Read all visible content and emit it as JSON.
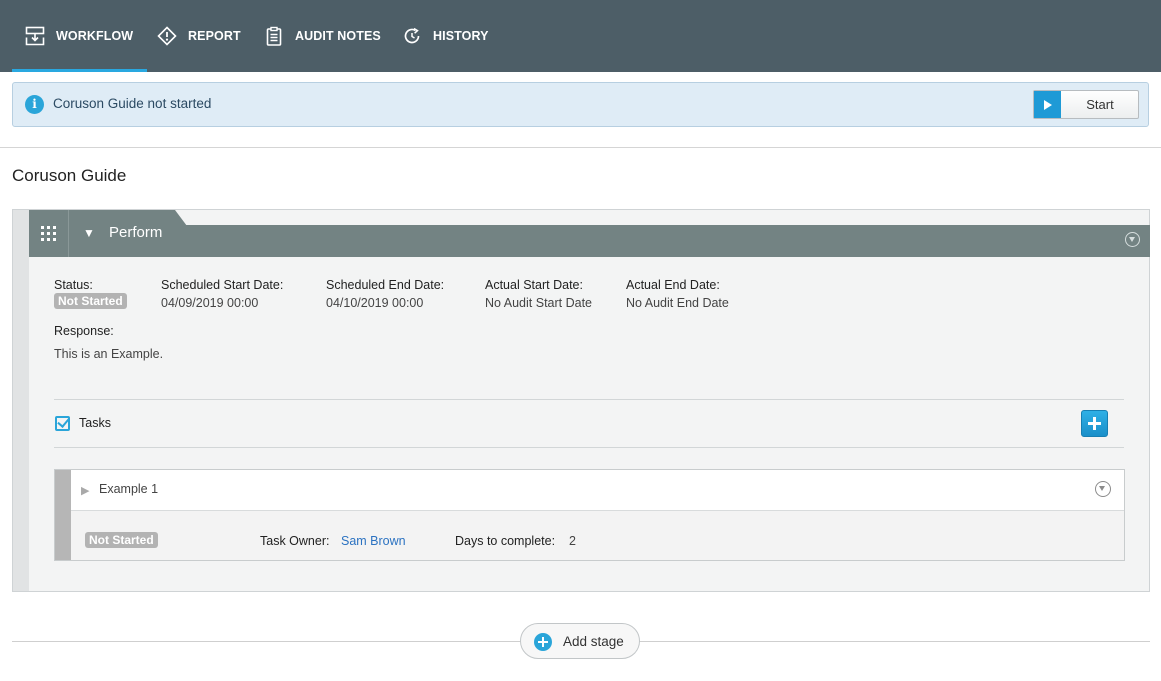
{
  "nav": {
    "tabs": [
      {
        "label": "WORKFLOW",
        "icon": "workflow-icon",
        "active": true
      },
      {
        "label": "REPORT",
        "icon": "report-icon",
        "active": false
      },
      {
        "label": "AUDIT NOTES",
        "icon": "clipboard-icon",
        "active": false
      },
      {
        "label": "HISTORY",
        "icon": "history-icon",
        "active": false
      }
    ]
  },
  "banner": {
    "icon": "info-icon",
    "message": "Coruson Guide not started",
    "start_label": "Start"
  },
  "page": {
    "title": "Coruson Guide"
  },
  "stage": {
    "name": "Perform",
    "status_label": "Status:",
    "status_value": "Not Started",
    "scheduled_start_label": "Scheduled Start Date:",
    "scheduled_start_value": "04/09/2019 00:00",
    "scheduled_end_label": "Scheduled End Date:",
    "scheduled_end_value": "04/10/2019 00:00",
    "actual_start_label": "Actual Start Date:",
    "actual_start_value": "No Audit Start Date",
    "actual_end_label": "Actual End Date:",
    "actual_end_value": "No Audit End Date",
    "response_label": "Response:",
    "response_value": "This is an Example.",
    "tasks_label": "Tasks"
  },
  "task": {
    "name": "Example 1",
    "status": "Not Started",
    "owner_label": "Task Owner:",
    "owner_value": "Sam Brown",
    "days_label": "Days to complete:",
    "days_value": "2"
  },
  "footer": {
    "add_stage_label": "Add stage"
  },
  "colors": {
    "nav_bg": "#4d5e67",
    "accent": "#29a8e0",
    "stage_header": "#738383",
    "badge": "#b3b3b3",
    "link": "#2b72c1"
  }
}
